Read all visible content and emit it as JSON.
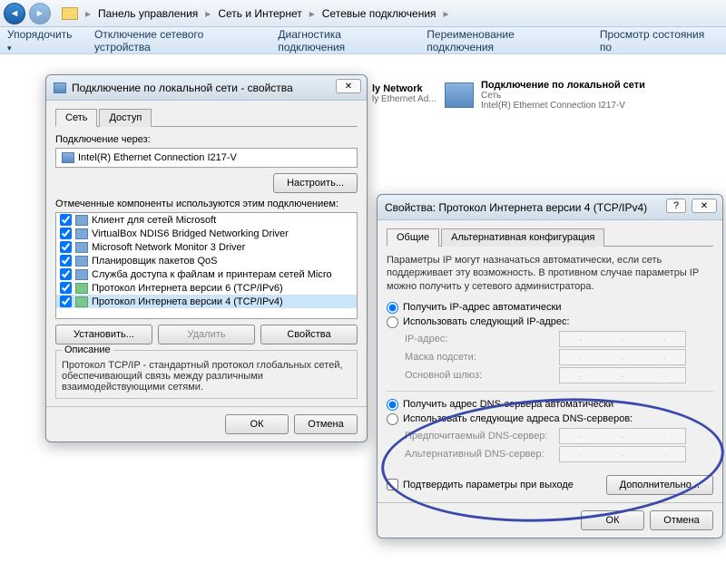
{
  "breadcrumbs": [
    "Панель управления",
    "Сеть и Интернет",
    "Сетевые подключения"
  ],
  "toolbar": {
    "organize": "Упорядочить",
    "disable": "Отключение сетевого устройства",
    "diagnose": "Диагностика подключения",
    "rename": "Переименование подключения",
    "status": "Просмотр состояния по"
  },
  "content_items": [
    {
      "title": "ly Network",
      "sub": "ly Ethernet Ad..."
    },
    {
      "title": "Подключение по локальной сети",
      "sub1": "Сеть",
      "sub2": "Intel(R) Ethernet Connection I217-V"
    }
  ],
  "props_dialog": {
    "title": "Подключение по локальной сети - свойства",
    "tabs": [
      "Сеть",
      "Доступ"
    ],
    "connect_via": "Подключение через:",
    "adapter": "Intel(R) Ethernet Connection I217-V",
    "configure": "Настроить...",
    "components_label": "Отмеченные компоненты используются этим подключением:",
    "components": [
      "Клиент для сетей Microsoft",
      "VirtualBox NDIS6 Bridged Networking Driver",
      "Microsoft Network Monitor 3 Driver",
      "Планировщик пакетов QoS",
      "Служба доступа к файлам и принтерам сетей Micro",
      "Протокол Интернета версии 6 (TCP/IPv6)",
      "Протокол Интернета версии 4 (TCP/IPv4)"
    ],
    "install": "Установить...",
    "uninstall": "Удалить",
    "properties": "Свойства",
    "desc_title": "Описание",
    "desc_text": "Протокол TCP/IP - стандартный протокол глобальных сетей, обеспечивающий связь между различными взаимодействующими сетями.",
    "ok": "ОК",
    "cancel": "Отмена"
  },
  "tcpip_dialog": {
    "title": "Свойства: Протокол Интернета версии 4 (TCP/IPv4)",
    "tabs": [
      "Общие",
      "Альтернативная конфигурация"
    ],
    "help": "Параметры IP могут назначаться автоматически, если сеть поддерживает эту возможность. В противном случае параметры IP можно получить у сетевого администратора.",
    "ip_auto": "Получить IP-адрес автоматически",
    "ip_manual": "Использовать следующий IP-адрес:",
    "ip_label": "IP-адрес:",
    "mask_label": "Маска подсети:",
    "gateway_label": "Основной шлюз:",
    "dns_auto": "Получить адрес DNS-сервера автоматически",
    "dns_manual": "Использовать следующие адреса DNS-серверов:",
    "dns_pref": "Предпочитаемый DNS-сервер:",
    "dns_alt": "Альтернативный DNS-сервер:",
    "validate": "Подтвердить параметры при выходе",
    "advanced": "Дополнительно...",
    "ok": "ОК",
    "cancel": "Отмена"
  }
}
